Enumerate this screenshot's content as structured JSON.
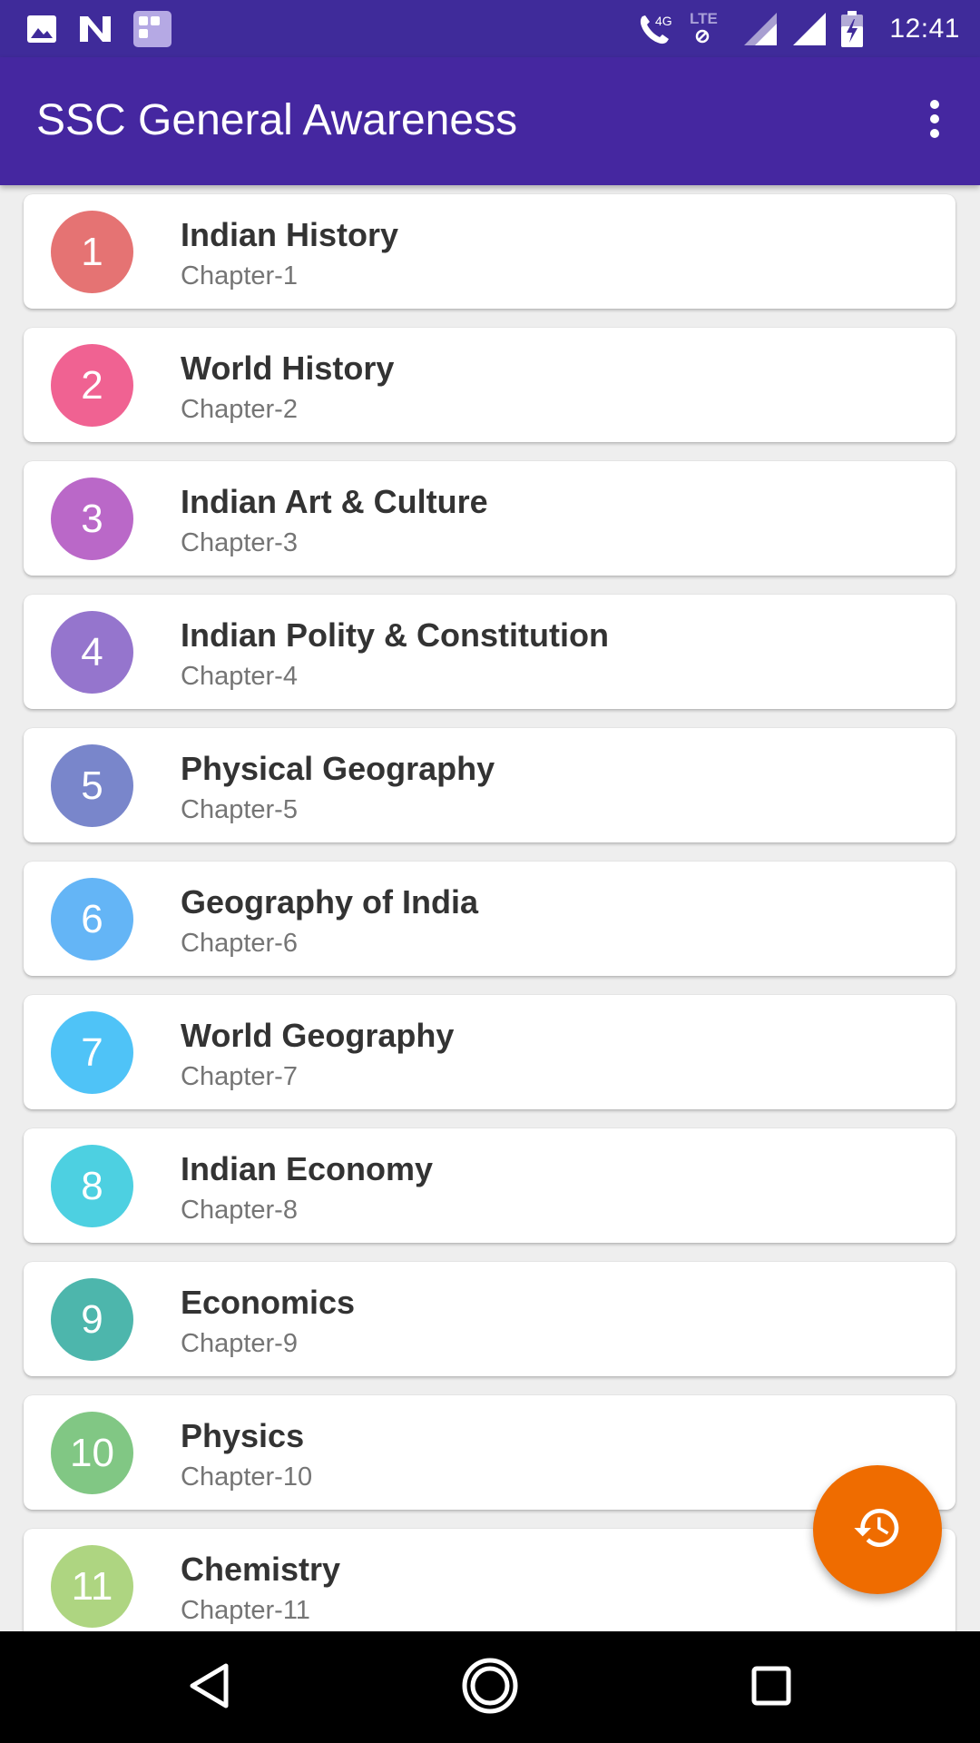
{
  "status_bar": {
    "time": "12:41",
    "left_icons": [
      "image-icon",
      "n-notification-icon",
      "app-grid-icon"
    ],
    "right_icons": [
      "wifi-calling-4g-icon",
      "lte-icon",
      "signal-icon-1",
      "signal-icon-2",
      "battery-icon"
    ],
    "call_label": "4G",
    "lte_label": "LTE"
  },
  "app_bar": {
    "title": "SSC General Awareness",
    "menu_icon": "more-vert-icon"
  },
  "chapters": [
    {
      "number": "1",
      "title": "Indian History",
      "subtitle": "Chapter-1",
      "color": "#e57373"
    },
    {
      "number": "2",
      "title": "World History",
      "subtitle": "Chapter-2",
      "color": "#f06292"
    },
    {
      "number": "3",
      "title": "Indian Art & Culture",
      "subtitle": "Chapter-3",
      "color": "#ba68c8"
    },
    {
      "number": "4",
      "title": "Indian Polity & Constitution",
      "subtitle": "Chapter-4",
      "color": "#9575cd"
    },
    {
      "number": "5",
      "title": "Physical Geography",
      "subtitle": "Chapter-5",
      "color": "#7986cb"
    },
    {
      "number": "6",
      "title": "Geography of India",
      "subtitle": "Chapter-6",
      "color": "#64b5f6"
    },
    {
      "number": "7",
      "title": "World Geography",
      "subtitle": "Chapter-7",
      "color": "#4fc3f7"
    },
    {
      "number": "8",
      "title": "Indian Economy",
      "subtitle": "Chapter-8",
      "color": "#4dd0e1"
    },
    {
      "number": "9",
      "title": "Economics",
      "subtitle": "Chapter-9",
      "color": "#4db6ac"
    },
    {
      "number": "10",
      "title": "Physics",
      "subtitle": "Chapter-10",
      "color": "#81c784"
    },
    {
      "number": "11",
      "title": "Chemistry",
      "subtitle": "Chapter-11",
      "color": "#aed581"
    }
  ],
  "fab": {
    "icon": "history-icon",
    "color": "#ef6c00"
  },
  "nav_bar": {
    "buttons": [
      "back-icon",
      "home-icon",
      "recents-icon"
    ]
  },
  "theme": {
    "primary": "#4527a0",
    "primary_dark": "#3f2b9a",
    "background": "#eeeeee"
  }
}
